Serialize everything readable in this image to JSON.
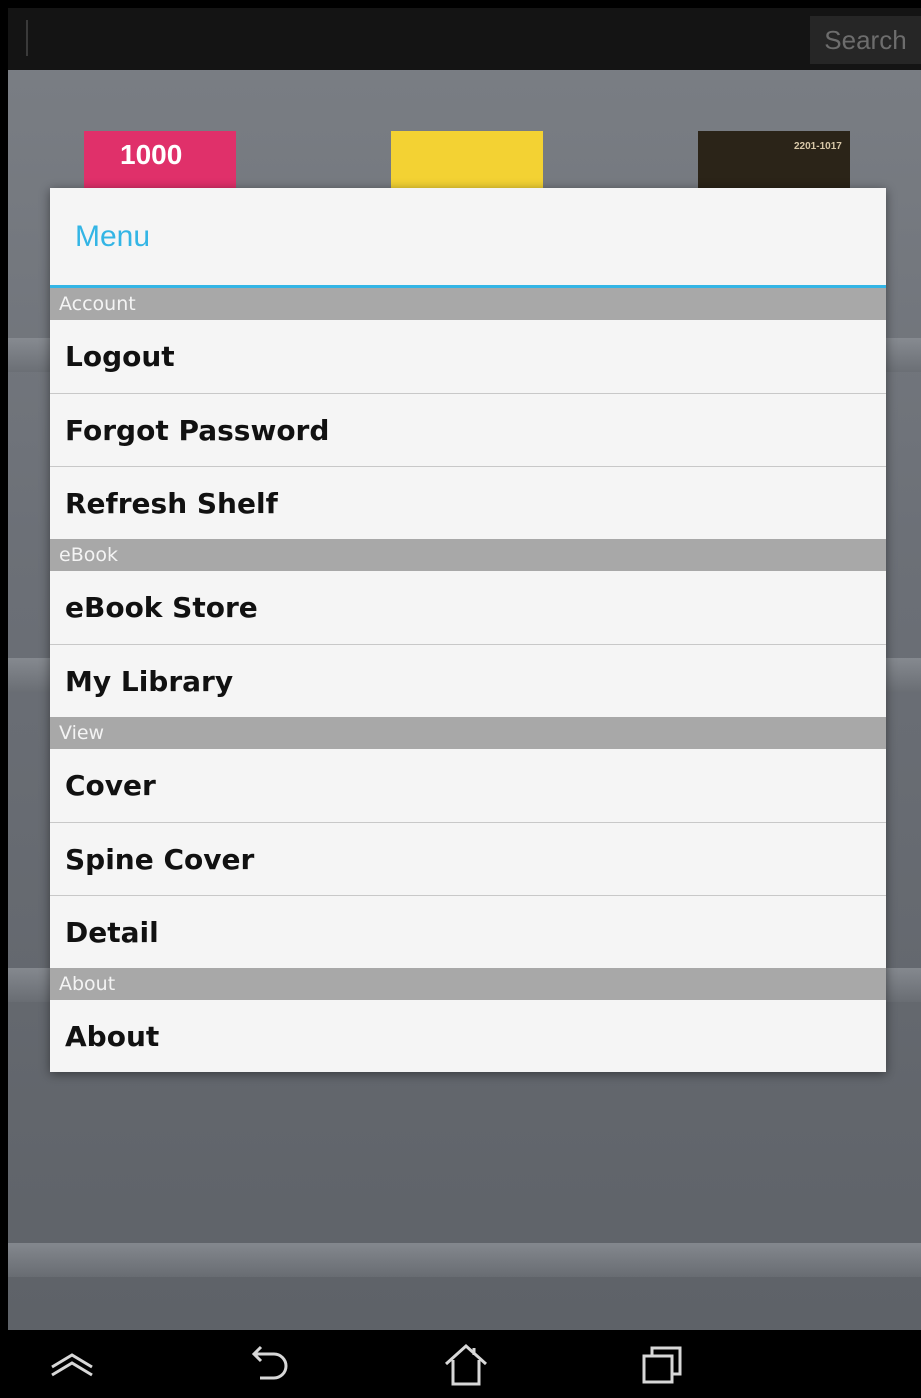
{
  "topbar": {
    "search_button_label": "Search",
    "search_placeholder": ""
  },
  "books": [
    {
      "cover_text": "1000",
      "color": "#e0306a"
    },
    {
      "cover_text": "",
      "color": "#f3d233"
    },
    {
      "cover_text": "2201-1017",
      "color": "#2b2418"
    }
  ],
  "dialog": {
    "title": "Menu",
    "accent_color": "#33b5e5",
    "sections": [
      {
        "header": "Account",
        "items": [
          "Logout",
          "Forgot Password",
          "Refresh Shelf"
        ]
      },
      {
        "header": "eBook",
        "items": [
          "eBook Store",
          "My Library"
        ]
      },
      {
        "header": "View",
        "items": [
          "Cover",
          "Spine Cover",
          "Detail"
        ]
      },
      {
        "header": "About",
        "items": [
          "About"
        ]
      }
    ]
  },
  "navbar": {
    "buttons": [
      "chevron-up-icon",
      "back-icon",
      "home-icon",
      "recent-apps-icon"
    ]
  }
}
